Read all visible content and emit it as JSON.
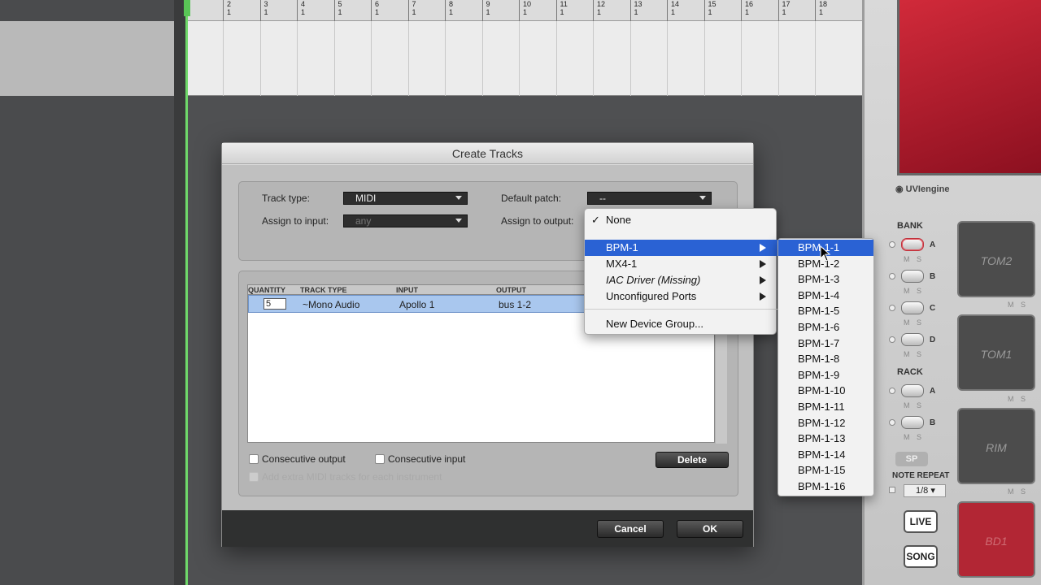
{
  "ruler": {
    "bars": [
      {
        "num": "2",
        "sub": "1"
      },
      {
        "num": "3",
        "sub": "1"
      },
      {
        "num": "4",
        "sub": "1"
      },
      {
        "num": "5",
        "sub": "1"
      },
      {
        "num": "6",
        "sub": "1"
      },
      {
        "num": "7",
        "sub": "1"
      },
      {
        "num": "8",
        "sub": "1"
      },
      {
        "num": "9",
        "sub": "1"
      },
      {
        "num": "10",
        "sub": "1"
      },
      {
        "num": "11",
        "sub": "1"
      },
      {
        "num": "12",
        "sub": "1"
      },
      {
        "num": "13",
        "sub": "1"
      },
      {
        "num": "14",
        "sub": "1"
      },
      {
        "num": "15",
        "sub": "1"
      },
      {
        "num": "16",
        "sub": "1"
      },
      {
        "num": "17",
        "sub": "1"
      },
      {
        "num": "18",
        "sub": "1"
      }
    ]
  },
  "dialog": {
    "title": "Create Tracks",
    "track_type_label": "Track type:",
    "track_type_value": "MIDI",
    "assign_input_label": "Assign to input:",
    "assign_input_value": "any",
    "default_patch_label": "Default patch:",
    "default_patch_value": "--",
    "assign_output_label": "Assign to output:",
    "table": {
      "headers": [
        "QUANTITY",
        "TRACK TYPE",
        "INPUT",
        "OUTPUT"
      ],
      "row": {
        "quantity": "5",
        "track_type": "~Mono Audio",
        "input": "Apollo 1",
        "output": "bus 1-2"
      }
    },
    "consecutive_output": "Consecutive output",
    "consecutive_input": "Consecutive input",
    "add_extra_midi": "Add extra MIDI tracks for each instrument",
    "delete_label": "Delete",
    "cancel_label": "Cancel",
    "ok_label": "OK"
  },
  "output_menu": {
    "items": [
      {
        "label": "None",
        "checked": true
      },
      {
        "label": "BPM-1",
        "submenu": true,
        "selected": true
      },
      {
        "label": "MX4-1",
        "submenu": true
      },
      {
        "label": "IAC Driver (Missing)",
        "submenu": true,
        "italic": true
      },
      {
        "label": "Unconfigured Ports",
        "submenu": true
      },
      {
        "label": "New Device Group..."
      }
    ],
    "submenu_items": [
      "BPM-1-1",
      "BPM-1-2",
      "BPM-1-3",
      "BPM-1-4",
      "BPM-1-5",
      "BPM-1-6",
      "BPM-1-7",
      "BPM-1-8",
      "BPM-1-9",
      "BPM-1-10",
      "BPM-1-11",
      "BPM-1-12",
      "BPM-1-13",
      "BPM-1-14",
      "BPM-1-15",
      "BPM-1-16"
    ]
  },
  "plugin": {
    "engine": "UVIengine",
    "bank_label": "BANK",
    "rack_label": "RACK",
    "bank_letters": [
      "A",
      "B",
      "C",
      "D"
    ],
    "rack_letters": [
      "A",
      "B"
    ],
    "sp_label": "SP",
    "note_repeat_label": "NOTE REPEAT",
    "note_repeat_value": "1/8",
    "live_label": "LIVE",
    "song_label": "SONG",
    "pads": [
      "TOM2",
      "TOM1",
      "RIM",
      "BD1"
    ],
    "ms": "M S",
    "accent": "#b22634"
  },
  "colors": {
    "menu_highlight": "#2a62d4",
    "playhead": "#6fd86a"
  }
}
